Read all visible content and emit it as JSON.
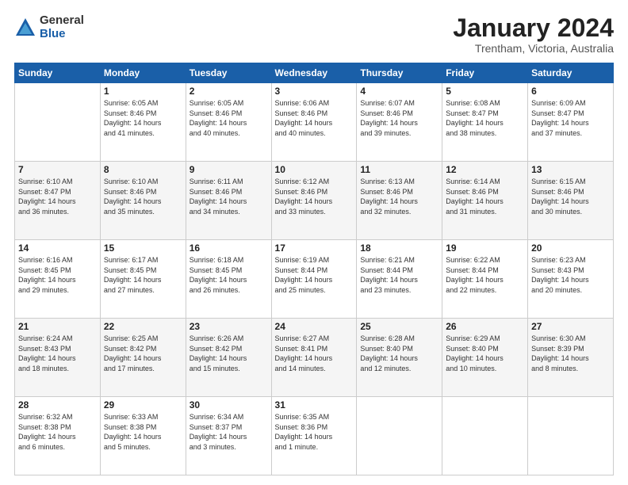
{
  "logo": {
    "general": "General",
    "blue": "Blue"
  },
  "header": {
    "month": "January 2024",
    "location": "Trentham, Victoria, Australia"
  },
  "weekdays": [
    "Sunday",
    "Monday",
    "Tuesday",
    "Wednesday",
    "Thursday",
    "Friday",
    "Saturday"
  ],
  "weeks": [
    [
      {
        "day": "",
        "info": ""
      },
      {
        "day": "1",
        "info": "Sunrise: 6:05 AM\nSunset: 8:46 PM\nDaylight: 14 hours\nand 41 minutes."
      },
      {
        "day": "2",
        "info": "Sunrise: 6:05 AM\nSunset: 8:46 PM\nDaylight: 14 hours\nand 40 minutes."
      },
      {
        "day": "3",
        "info": "Sunrise: 6:06 AM\nSunset: 8:46 PM\nDaylight: 14 hours\nand 40 minutes."
      },
      {
        "day": "4",
        "info": "Sunrise: 6:07 AM\nSunset: 8:46 PM\nDaylight: 14 hours\nand 39 minutes."
      },
      {
        "day": "5",
        "info": "Sunrise: 6:08 AM\nSunset: 8:47 PM\nDaylight: 14 hours\nand 38 minutes."
      },
      {
        "day": "6",
        "info": "Sunrise: 6:09 AM\nSunset: 8:47 PM\nDaylight: 14 hours\nand 37 minutes."
      }
    ],
    [
      {
        "day": "7",
        "info": "Sunrise: 6:10 AM\nSunset: 8:47 PM\nDaylight: 14 hours\nand 36 minutes."
      },
      {
        "day": "8",
        "info": "Sunrise: 6:10 AM\nSunset: 8:46 PM\nDaylight: 14 hours\nand 35 minutes."
      },
      {
        "day": "9",
        "info": "Sunrise: 6:11 AM\nSunset: 8:46 PM\nDaylight: 14 hours\nand 34 minutes."
      },
      {
        "day": "10",
        "info": "Sunrise: 6:12 AM\nSunset: 8:46 PM\nDaylight: 14 hours\nand 33 minutes."
      },
      {
        "day": "11",
        "info": "Sunrise: 6:13 AM\nSunset: 8:46 PM\nDaylight: 14 hours\nand 32 minutes."
      },
      {
        "day": "12",
        "info": "Sunrise: 6:14 AM\nSunset: 8:46 PM\nDaylight: 14 hours\nand 31 minutes."
      },
      {
        "day": "13",
        "info": "Sunrise: 6:15 AM\nSunset: 8:46 PM\nDaylight: 14 hours\nand 30 minutes."
      }
    ],
    [
      {
        "day": "14",
        "info": "Sunrise: 6:16 AM\nSunset: 8:45 PM\nDaylight: 14 hours\nand 29 minutes."
      },
      {
        "day": "15",
        "info": "Sunrise: 6:17 AM\nSunset: 8:45 PM\nDaylight: 14 hours\nand 27 minutes."
      },
      {
        "day": "16",
        "info": "Sunrise: 6:18 AM\nSunset: 8:45 PM\nDaylight: 14 hours\nand 26 minutes."
      },
      {
        "day": "17",
        "info": "Sunrise: 6:19 AM\nSunset: 8:44 PM\nDaylight: 14 hours\nand 25 minutes."
      },
      {
        "day": "18",
        "info": "Sunrise: 6:21 AM\nSunset: 8:44 PM\nDaylight: 14 hours\nand 23 minutes."
      },
      {
        "day": "19",
        "info": "Sunrise: 6:22 AM\nSunset: 8:44 PM\nDaylight: 14 hours\nand 22 minutes."
      },
      {
        "day": "20",
        "info": "Sunrise: 6:23 AM\nSunset: 8:43 PM\nDaylight: 14 hours\nand 20 minutes."
      }
    ],
    [
      {
        "day": "21",
        "info": "Sunrise: 6:24 AM\nSunset: 8:43 PM\nDaylight: 14 hours\nand 18 minutes."
      },
      {
        "day": "22",
        "info": "Sunrise: 6:25 AM\nSunset: 8:42 PM\nDaylight: 14 hours\nand 17 minutes."
      },
      {
        "day": "23",
        "info": "Sunrise: 6:26 AM\nSunset: 8:42 PM\nDaylight: 14 hours\nand 15 minutes."
      },
      {
        "day": "24",
        "info": "Sunrise: 6:27 AM\nSunset: 8:41 PM\nDaylight: 14 hours\nand 14 minutes."
      },
      {
        "day": "25",
        "info": "Sunrise: 6:28 AM\nSunset: 8:40 PM\nDaylight: 14 hours\nand 12 minutes."
      },
      {
        "day": "26",
        "info": "Sunrise: 6:29 AM\nSunset: 8:40 PM\nDaylight: 14 hours\nand 10 minutes."
      },
      {
        "day": "27",
        "info": "Sunrise: 6:30 AM\nSunset: 8:39 PM\nDaylight: 14 hours\nand 8 minutes."
      }
    ],
    [
      {
        "day": "28",
        "info": "Sunrise: 6:32 AM\nSunset: 8:38 PM\nDaylight: 14 hours\nand 6 minutes."
      },
      {
        "day": "29",
        "info": "Sunrise: 6:33 AM\nSunset: 8:38 PM\nDaylight: 14 hours\nand 5 minutes."
      },
      {
        "day": "30",
        "info": "Sunrise: 6:34 AM\nSunset: 8:37 PM\nDaylight: 14 hours\nand 3 minutes."
      },
      {
        "day": "31",
        "info": "Sunrise: 6:35 AM\nSunset: 8:36 PM\nDaylight: 14 hours\nand 1 minute."
      },
      {
        "day": "",
        "info": ""
      },
      {
        "day": "",
        "info": ""
      },
      {
        "day": "",
        "info": ""
      }
    ]
  ]
}
